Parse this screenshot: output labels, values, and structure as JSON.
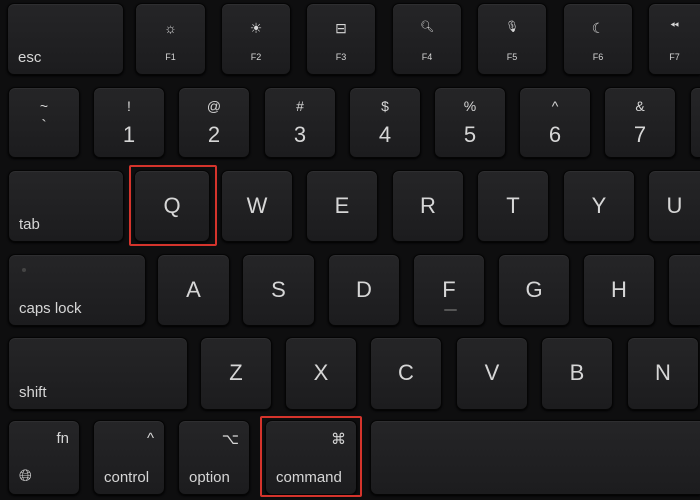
{
  "highlight_color": "#d5342c",
  "fn_row": [
    {
      "label": "esc"
    },
    {
      "icon": "brightness-down-icon",
      "glyph": "☼",
      "label": "F1"
    },
    {
      "icon": "brightness-up-icon",
      "glyph": "☀",
      "label": "F2"
    },
    {
      "icon": "mission-control-icon",
      "glyph": "⊟",
      "label": "F3"
    },
    {
      "icon": "search-icon",
      "glyph": "🔍︎",
      "label": "F4"
    },
    {
      "icon": "microphone-icon",
      "glyph": "🎙︎",
      "label": "F5"
    },
    {
      "icon": "moon-icon",
      "glyph": "☾",
      "label": "F6"
    },
    {
      "icon": "rewind-icon",
      "glyph": "⏪︎",
      "label": "F7"
    }
  ],
  "number_row": [
    {
      "top": "~",
      "bottom": "`"
    },
    {
      "top": "!",
      "bottom": "1"
    },
    {
      "top": "@",
      "bottom": "2"
    },
    {
      "top": "#",
      "bottom": "3"
    },
    {
      "top": "$",
      "bottom": "4"
    },
    {
      "top": "%",
      "bottom": "5"
    },
    {
      "top": "^",
      "bottom": "6"
    },
    {
      "top": "&",
      "bottom": "7"
    }
  ],
  "qwerty_row": {
    "tab": "tab",
    "keys": [
      "Q",
      "W",
      "E",
      "R",
      "T",
      "Y",
      "U"
    ]
  },
  "home_row": {
    "caps": "caps lock",
    "keys": [
      "A",
      "S",
      "D",
      "F",
      "G",
      "H"
    ]
  },
  "bottom_letter_row": {
    "shift": "shift",
    "keys": [
      "Z",
      "X",
      "C",
      "V",
      "B",
      "N"
    ]
  },
  "modifier_row": {
    "fn": "fn",
    "control": "control",
    "control_symbol": "^",
    "option": "option",
    "option_symbol": "⌥",
    "command": "command",
    "command_symbol": "⌘"
  },
  "highlighted_keys": [
    "Q",
    "command"
  ]
}
